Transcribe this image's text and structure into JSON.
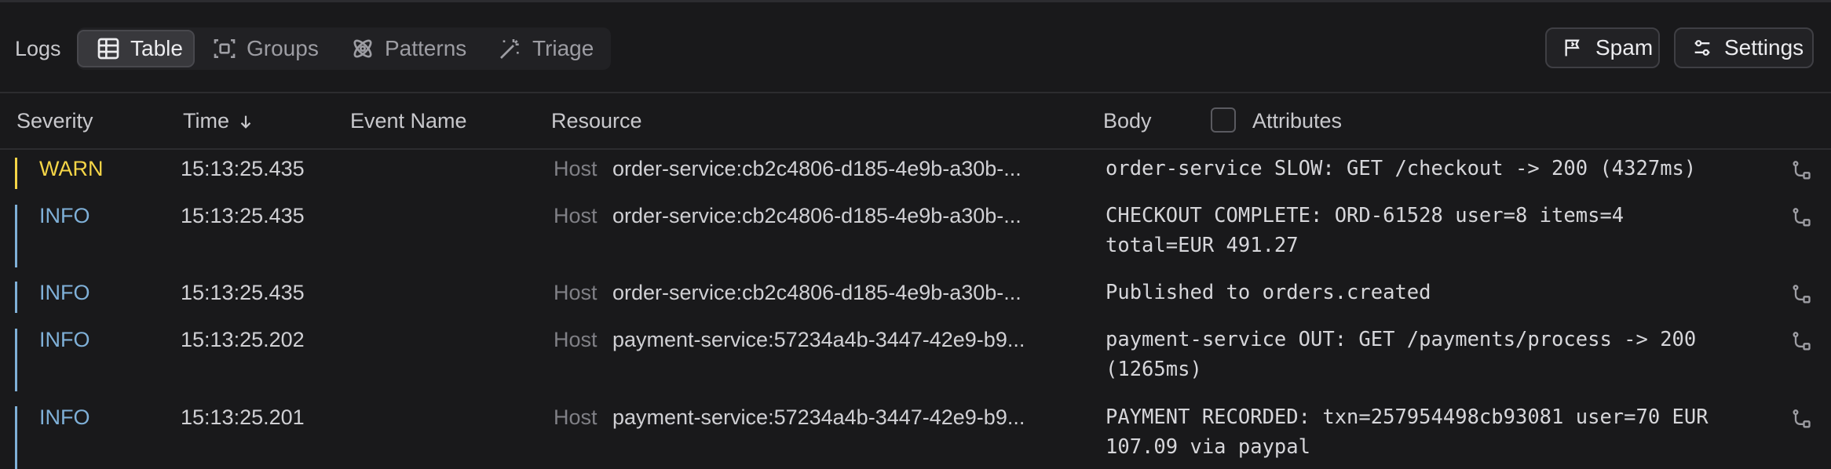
{
  "toolbar": {
    "logs_label": "Logs",
    "tabs": [
      {
        "label": "Table",
        "icon": "table-icon",
        "active": true
      },
      {
        "label": "Groups",
        "icon": "groups-icon",
        "active": false
      },
      {
        "label": "Patterns",
        "icon": "patterns-icon",
        "active": false
      },
      {
        "label": "Triage",
        "icon": "magic-wand-icon",
        "active": false
      }
    ],
    "spam_label": "Spam",
    "settings_label": "Settings"
  },
  "columns": {
    "severity": "Severity",
    "time": "Time",
    "time_sort_icon": "arrow-down-icon",
    "event_name": "Event Name",
    "resource": "Resource",
    "body": "Body",
    "attributes": "Attributes",
    "attributes_checked": false
  },
  "colors": {
    "warn": "#f5d547",
    "info": "#7fb0d8"
  },
  "rows": [
    {
      "severity": "WARN",
      "time": "15:13:25.435",
      "event_name": "",
      "host_label": "Host",
      "resource": "order-service:cb2c4806-d185-4e9b-a30b-...",
      "body": "order-service SLOW: GET /checkout -> 200 (4327ms)"
    },
    {
      "severity": "INFO",
      "time": "15:13:25.435",
      "event_name": "",
      "host_label": "Host",
      "resource": "order-service:cb2c4806-d185-4e9b-a30b-...",
      "body": "CHECKOUT COMPLETE: ORD-61528 user=8 items=4\ntotal=EUR 491.27"
    },
    {
      "severity": "INFO",
      "time": "15:13:25.435",
      "event_name": "",
      "host_label": "Host",
      "resource": "order-service:cb2c4806-d185-4e9b-a30b-...",
      "body": "Published to orders.created"
    },
    {
      "severity": "INFO",
      "time": "15:13:25.202",
      "event_name": "",
      "host_label": "Host",
      "resource": "payment-service:57234a4b-3447-42e9-b9...",
      "body": "payment-service OUT: GET /payments/process -> 200\n(1265ms)"
    },
    {
      "severity": "INFO",
      "time": "15:13:25.201",
      "event_name": "",
      "host_label": "Host",
      "resource": "payment-service:57234a4b-3447-42e9-b9...",
      "body": "PAYMENT RECORDED: txn=257954498cb93081 user=70 EUR\n107.09 via paypal"
    }
  ]
}
